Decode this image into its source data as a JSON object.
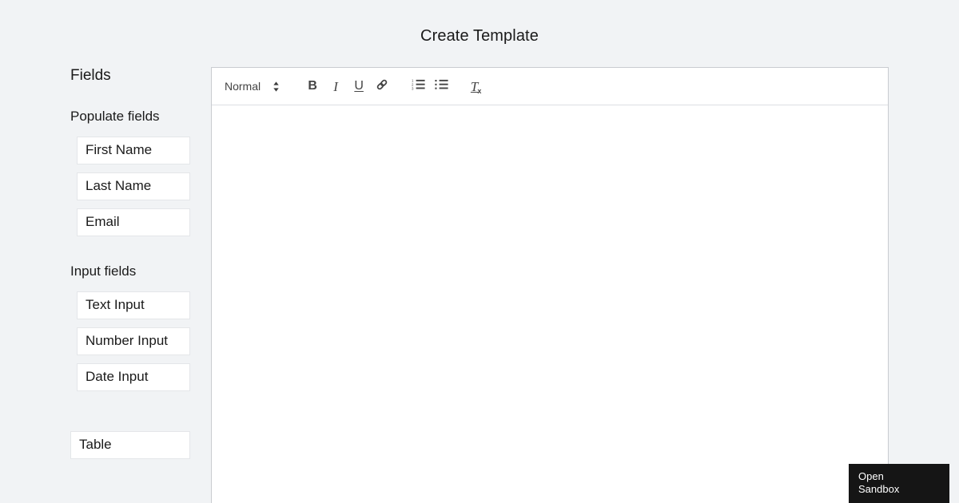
{
  "page": {
    "title": "Create Template",
    "background_color": "#f1f3f5"
  },
  "sidebar": {
    "heading": "Fields",
    "groups": [
      {
        "label": "Populate fields",
        "items": [
          {
            "label": "First Name"
          },
          {
            "label": "Last Name"
          },
          {
            "label": "Email"
          }
        ]
      },
      {
        "label": "Input fields",
        "items": [
          {
            "label": "Text Input"
          },
          {
            "label": "Number Input"
          },
          {
            "label": "Date Input"
          }
        ]
      }
    ],
    "extra": [
      {
        "label": "Table"
      }
    ]
  },
  "editor": {
    "toolbar": {
      "format_picker": {
        "value": "Normal",
        "icon": "chevron-up-down-icon"
      },
      "buttons": [
        {
          "name": "bold",
          "glyph": "B",
          "icon": "bold-icon"
        },
        {
          "name": "italic",
          "glyph": "I",
          "icon": "italic-icon"
        },
        {
          "name": "underline",
          "glyph": "U",
          "icon": "underline-icon"
        },
        {
          "name": "link",
          "glyph": "",
          "icon": "link-icon"
        },
        {
          "name": "ordered-list",
          "glyph": "",
          "icon": "ordered-list-icon"
        },
        {
          "name": "bullet-list",
          "glyph": "",
          "icon": "bullet-list-icon"
        },
        {
          "name": "clear-format",
          "glyph": "T",
          "icon": "clear-formatting-icon"
        }
      ]
    },
    "content": "",
    "background_color": "#ffffff",
    "border_color": "#c9ccd0"
  },
  "sandbox_badge": {
    "line1": "Open",
    "line2": "Sandbox",
    "background_color": "#151515",
    "text_color": "#ffffff"
  }
}
